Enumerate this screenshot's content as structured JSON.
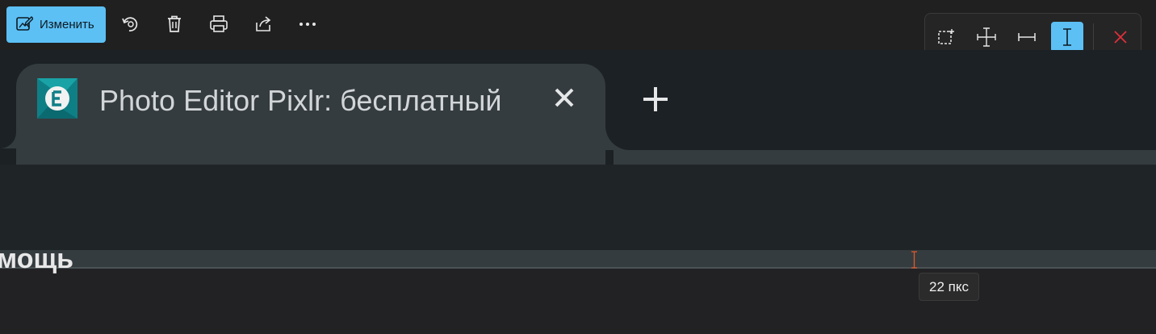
{
  "toolbar": {
    "edit_label": "Изменить",
    "icons": [
      "edit-image-icon",
      "rotate-icon",
      "delete-icon",
      "print-icon",
      "share-icon",
      "more-icon"
    ]
  },
  "measure_toolbar": {
    "tools": [
      "select-area-icon",
      "crosshair-measure-icon",
      "horizontal-measure-icon",
      "vertical-measure-icon"
    ],
    "active_tool": "vertical-measure-icon",
    "close_icon": "close-icon",
    "accent_color": "#5cc0f5",
    "close_color": "#e0303a"
  },
  "browser": {
    "tab_title": "Photo Editor Pixlr: бесплатный",
    "favicon": "pixlr-e-logo",
    "tab_close_icon": "close-icon",
    "new_tab_icon": "plus-icon"
  },
  "page": {
    "text_fragment": "мощь"
  },
  "measurement": {
    "readout": "22 пкс",
    "marker_color": "#e05a28"
  }
}
